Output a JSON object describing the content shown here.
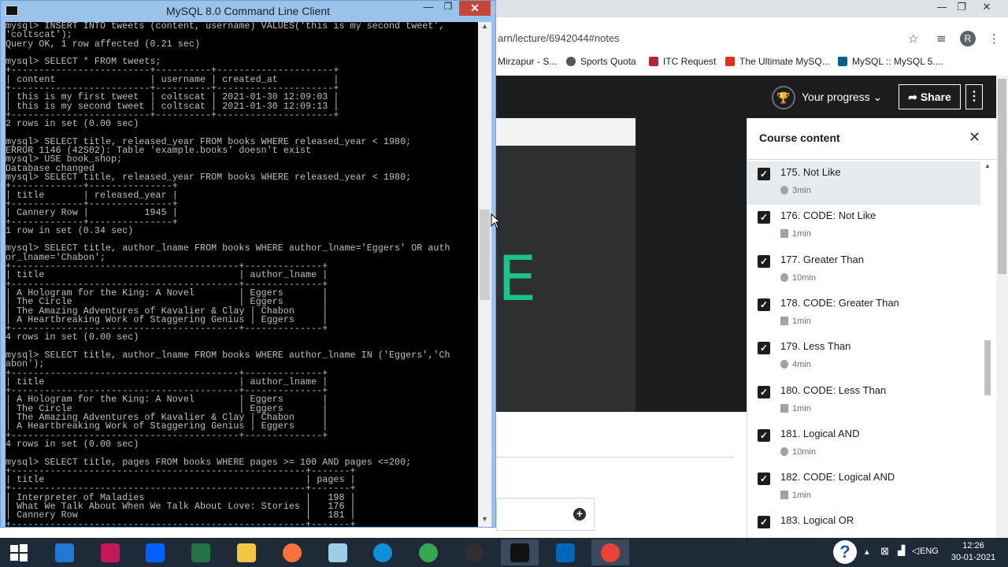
{
  "cmd": {
    "title": "MySQL 8.0 Command Line Client",
    "minimize": "—",
    "maximize": "❐",
    "close": "✕",
    "lines": [
      "mysql> INSERT INTO tweets (content, username) VALUES('this is my second tweet',",
      "'coltscat');",
      "Query OK, 1 row affected (0.21 sec)",
      "",
      "mysql> SELECT * FROM tweets;",
      "+-------------------------+----------+---------------------+",
      "| content                 | username | created_at          |",
      "+-------------------------+----------+---------------------+",
      "| this is my first tweet  | coltscat | 2021-01-30 12:09:03 |",
      "| this is my second tweet | coltscat | 2021-01-30 12:09:13 |",
      "+-------------------------+----------+---------------------+",
      "2 rows in set (0.00 sec)",
      "",
      "mysql> SELECT title, released_year FROM books WHERE released_year < 1980;",
      "ERROR 1146 (42S02): Table 'example.books' doesn't exist",
      "mysql> USE book_shop;",
      "Database changed",
      "mysql> SELECT title, released_year FROM books WHERE released_year < 1980;",
      "+-------------+---------------+",
      "| title       | released_year |",
      "+-------------+---------------+",
      "| Cannery Row |          1945 |",
      "+-------------+---------------+",
      "1 row in set (0.34 sec)",
      "",
      "mysql> SELECT title, author_lname FROM books WHERE author_lname='Eggers' OR auth",
      "or_lname='Chabon';",
      "+-----------------------------------------+--------------+",
      "| title                                   | author_lname |",
      "+-----------------------------------------+--------------+",
      "| A Hologram for the King: A Novel        | Eggers       |",
      "| The Circle                              | Eggers       |",
      "| The Amazing Adventures of Kavalier & Clay | Chabon     |",
      "| A Heartbreaking Work of Staggering Genius | Eggers     |",
      "+-----------------------------------------+--------------+",
      "4 rows in set (0.00 sec)",
      "",
      "mysql> SELECT title, author_lname FROM books WHERE author_lname IN ('Eggers','Ch",
      "abon');",
      "+-----------------------------------------+--------------+",
      "| title                                   | author_lname |",
      "+-----------------------------------------+--------------+",
      "| A Hologram for the King: A Novel        | Eggers       |",
      "| The Circle                              | Eggers       |",
      "| The Amazing Adventures of Kavalier & Clay | Chabon     |",
      "| A Heartbreaking Work of Staggering Genius | Eggers     |",
      "+-----------------------------------------+--------------+",
      "4 rows in set (0.00 sec)",
      "",
      "mysql> SELECT title, pages FROM books WHERE pages >= 100 AND pages <=200;",
      "+-----------------------------------------------------+-------+",
      "| title                                               | pages |",
      "+-----------------------------------------------------+-------+",
      "| Interpreter of Maladies                             |   198 |",
      "| What We Talk About When We Talk About Love: Stories |   176 |",
      "| Cannery Row                                         |   181 |",
      "+-----------------------------------------------------+-------+"
    ]
  },
  "browser": {
    "address": "arn/lecture/6942044#notes",
    "avatar": "R",
    "bookmarks": [
      "Mirzapur - S...",
      "Sports Quota",
      "ITC Request",
      "The Ultimate MySQ...",
      "MySQL :: MySQL 5...."
    ],
    "progress_label": "Your progress",
    "share_label": "Share",
    "more_label": "⋮"
  },
  "video": {
    "letter": "E"
  },
  "sidebar": {
    "title": "Course content",
    "lectures": [
      {
        "title": "175. Not Like",
        "meta": "3min",
        "kind": "video",
        "active": true
      },
      {
        "title": "176. CODE: Not Like",
        "meta": "1min",
        "kind": "doc",
        "active": false
      },
      {
        "title": "177. Greater Than",
        "meta": "10min",
        "kind": "video",
        "active": false
      },
      {
        "title": "178. CODE: Greater Than",
        "meta": "1min",
        "kind": "doc",
        "active": false
      },
      {
        "title": "179. Less Than",
        "meta": "4min",
        "kind": "video",
        "active": false
      },
      {
        "title": "180. CODE: Less Than",
        "meta": "1min",
        "kind": "doc",
        "active": false
      },
      {
        "title": "181. Logical AND",
        "meta": "10min",
        "kind": "video",
        "active": false
      },
      {
        "title": "182. CODE: Logical AND",
        "meta": "1min",
        "kind": "doc",
        "active": false
      },
      {
        "title": "183. Logical OR",
        "meta": "",
        "kind": "video",
        "active": false
      }
    ]
  },
  "taskbar": {
    "apps": [
      "start",
      "internet-explorer",
      "photo-app",
      "dropbox",
      "calculator",
      "file-explorer",
      "firefox",
      "notepad",
      "edge",
      "chrome",
      "obs",
      "mysql",
      "vscode",
      "chrome-2"
    ],
    "language": "ENG",
    "time": "12:26",
    "date": "30-01-2021"
  }
}
